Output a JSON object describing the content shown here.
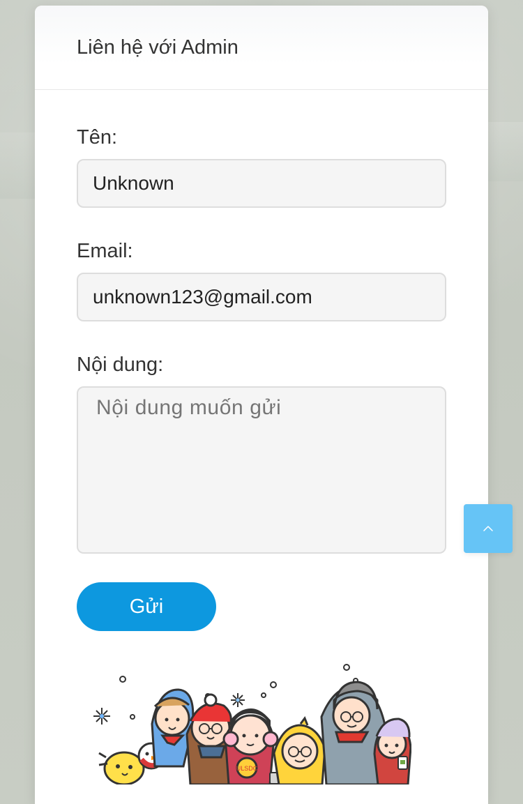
{
  "modal": {
    "title": "Liên hệ với Admin"
  },
  "form": {
    "name": {
      "label": "Tên:",
      "value": "Unknown",
      "placeholder": ""
    },
    "email": {
      "label": "Email:",
      "value": "unknown123@gmail.com",
      "placeholder": ""
    },
    "message": {
      "label": "Nội dung:",
      "value": "",
      "placeholder": "Nội dung muốn gửi"
    },
    "submit_label": "Gửi"
  },
  "illustration": {
    "badge_text": "ULSDC"
  },
  "scroll_top": {
    "icon": "chevron-up-icon"
  },
  "colors": {
    "backdrop": "#C7CCC3",
    "surface": "#FFFFFF",
    "field_background": "#F5F5F5",
    "field_border": "#DDDDDD",
    "primary": "#0D98DF",
    "scroll_button": "#66C4F6",
    "text": "#333333"
  }
}
